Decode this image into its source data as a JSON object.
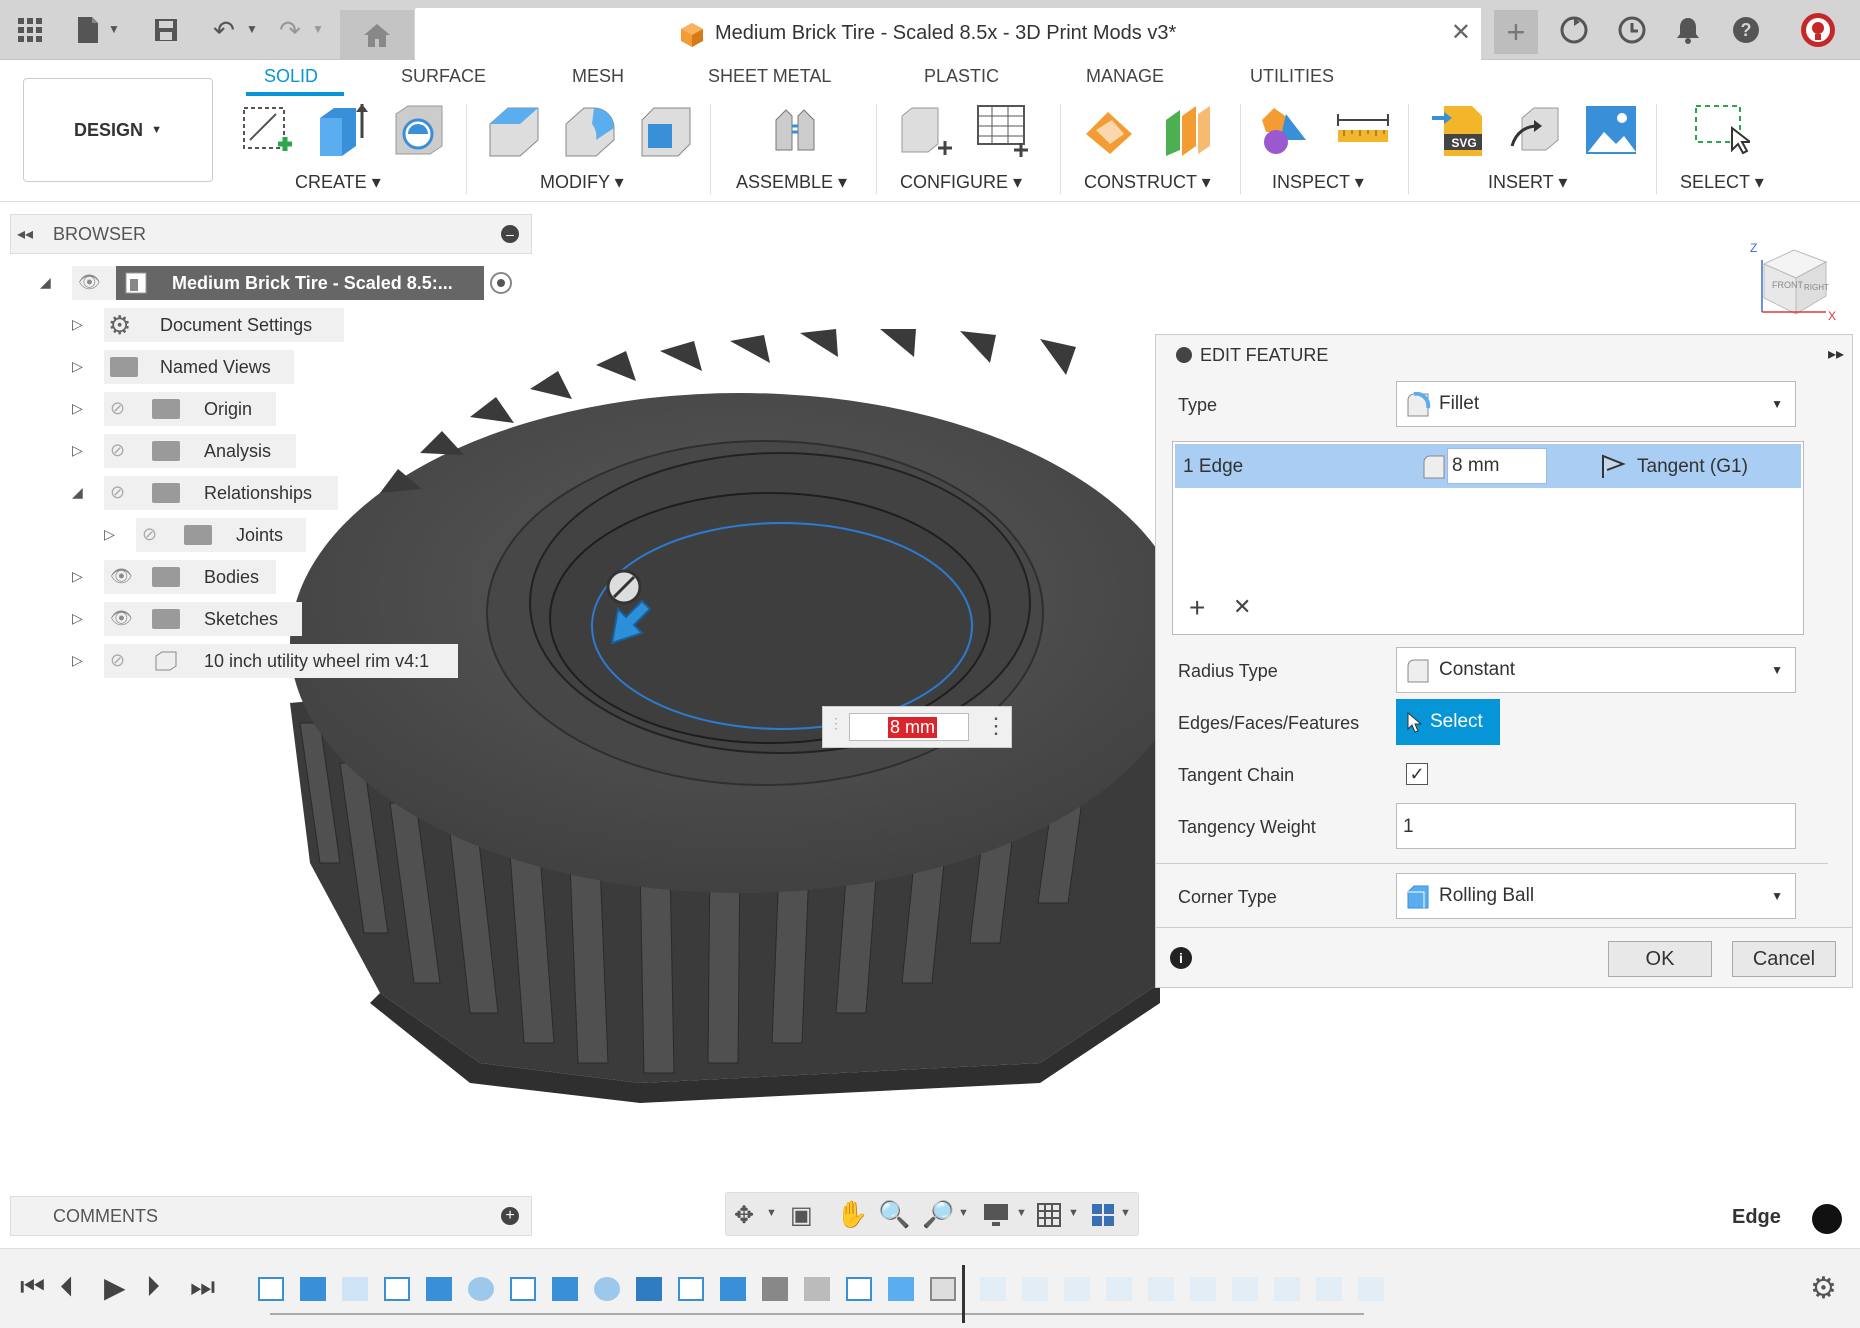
{
  "titlebar": {
    "document_title": "Medium Brick Tire - Scaled 8.5x - 3D Print Mods v3*",
    "icons": [
      "apps-grid-icon",
      "file-icon",
      "save-icon",
      "undo-icon",
      "redo-icon",
      "home-icon",
      "new-tab-icon",
      "sync-icon",
      "history-icon",
      "notification-bell-icon",
      "help-icon",
      "avatar-icon"
    ]
  },
  "toolbar": {
    "workspace": "DESIGN",
    "tabs": [
      {
        "label": "SOLID",
        "active": true
      },
      {
        "label": "SURFACE"
      },
      {
        "label": "MESH"
      },
      {
        "label": "SHEET METAL"
      },
      {
        "label": "PLASTIC"
      },
      {
        "label": "MANAGE"
      },
      {
        "label": "UTILITIES"
      }
    ],
    "groups": [
      "CREATE",
      "MODIFY",
      "ASSEMBLE",
      "CONFIGURE",
      "CONSTRUCT",
      "INSPECT",
      "INSERT",
      "SELECT"
    ]
  },
  "browser": {
    "title": "BROWSER",
    "root": "Medium Brick Tire - Scaled 8.5:...",
    "items": [
      {
        "label": "Document Settings"
      },
      {
        "label": "Named Views"
      },
      {
        "label": "Origin"
      },
      {
        "label": "Analysis"
      },
      {
        "label": "Relationships"
      },
      {
        "label": "Joints"
      },
      {
        "label": "Bodies"
      },
      {
        "label": "Sketches"
      },
      {
        "label": "10 inch utility wheel rim v4:1"
      }
    ]
  },
  "viewport": {
    "dimension_input": "8 mm",
    "viewcube": {
      "front": "FRONT",
      "right": "RIGHT",
      "z": "Z",
      "x": "X"
    }
  },
  "edit_feature": {
    "title": "EDIT FEATURE",
    "type_label": "Type",
    "type_value": "Fillet",
    "edge_row": {
      "selection": "1 Edge",
      "radius": "8 mm",
      "continuity": "Tangent (G1)"
    },
    "radius_type_label": "Radius Type",
    "radius_type_value": "Constant",
    "edges_label": "Edges/Faces/Features",
    "select_button": "Select",
    "tangent_chain_label": "Tangent Chain",
    "tangent_chain_checked": true,
    "tangency_weight_label": "Tangency Weight",
    "tangency_weight_value": "1",
    "corner_type_label": "Corner Type",
    "corner_type_value": "Rolling Ball",
    "ok": "OK",
    "cancel": "Cancel"
  },
  "comments": {
    "title": "COMMENTS"
  },
  "status": {
    "selection_filter": "Edge"
  },
  "colors": {
    "accent": "#0696d7",
    "selection_row": "#a9cdf3",
    "input_highlight": "#d9252b",
    "tire": "#4a4a4a"
  }
}
